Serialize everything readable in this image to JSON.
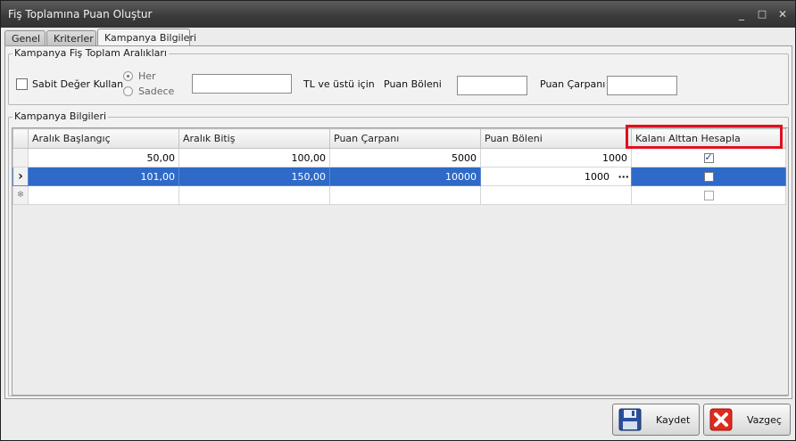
{
  "window": {
    "title": "Fiş Toplamına Puan Oluştur",
    "minimize_glyph": "_",
    "restore_glyph": "□",
    "close_glyph": "✕"
  },
  "tabs": [
    {
      "label": "Genel",
      "active": false
    },
    {
      "label": "Kriterler",
      "active": false
    },
    {
      "label": "Kampanya Bilgileri",
      "active": true
    }
  ],
  "ranges_group": {
    "title": "Kampanya Fiş Toplam Aralıkları",
    "fixed_value_label": "Sabit Değer Kullan",
    "fixed_value_checked": false,
    "radio_every": "Her",
    "radio_only": "Sadece",
    "selected_radio": "Her",
    "amount_value": "",
    "amount_suffix": "TL ve üstü için",
    "divisor_label": "Puan Böleni",
    "divisor_value": "",
    "multiplier_label": "Puan Çarpanı",
    "multiplier_value": ""
  },
  "campaign_group": {
    "title": "Kampanya Bilgileri",
    "columns": [
      "Aralık Başlangıç",
      "Aralık Bitiş",
      "Puan Çarpanı",
      "Puan Böleni",
      "Kalanı Alttan Hesapla"
    ],
    "rows": [
      {
        "start": "50,00",
        "end": "100,00",
        "multiplier": "5000",
        "divisor": "1000",
        "round_down": true,
        "selected": false
      },
      {
        "start": "101,00",
        "end": "150,00",
        "multiplier": "10000",
        "divisor": "1000",
        "round_down": false,
        "selected": true
      }
    ],
    "current_row_glyph": "›",
    "new_row_glyph": "✻",
    "ellipsis": "···"
  },
  "footer": {
    "save_label": "Kaydet",
    "cancel_label": "Vazgeç"
  },
  "colors": {
    "selection": "#2f6ac8",
    "highlight": "#e0101f"
  }
}
